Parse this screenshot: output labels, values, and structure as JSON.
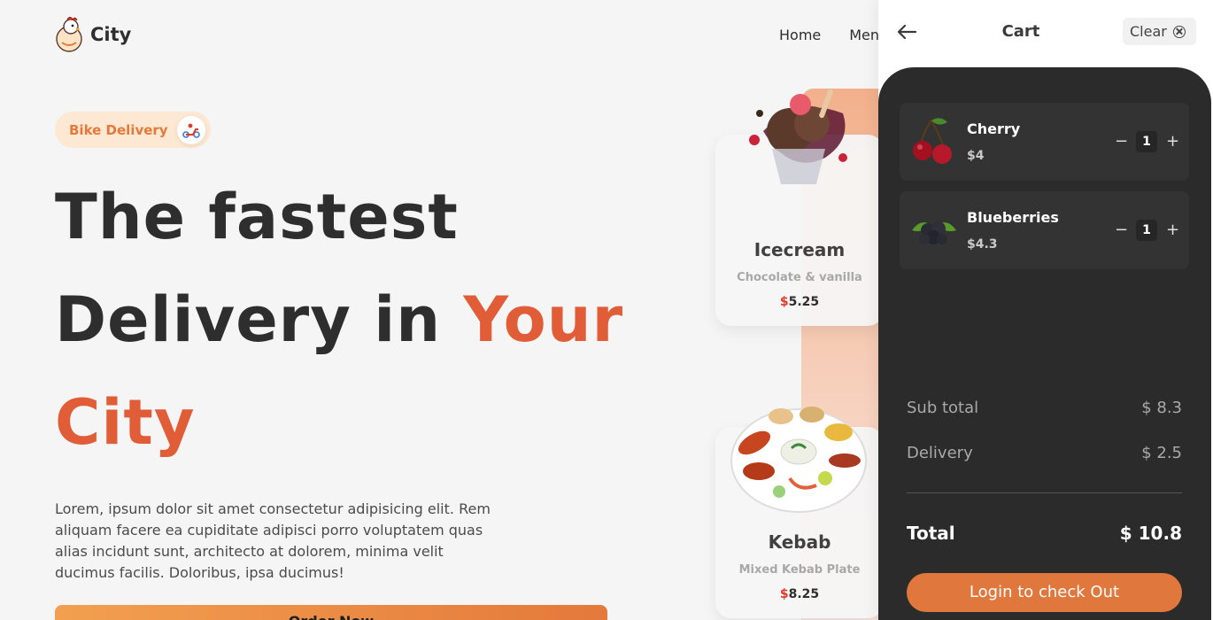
{
  "header": {
    "logo_text": "City",
    "nav": [
      "Home",
      "Menu"
    ]
  },
  "hero": {
    "badge_text": "Bike Delivery",
    "title_line1": "The fastest",
    "title_line2_plain": "Delivery in ",
    "title_line2_accent": "Your",
    "title_line3": "City",
    "paragraph": "Lorem, ipsum dolor sit amet consectetur adipisicing elit. Rem aliquam facere ea cupiditate adipisci porro voluptatem quas alias incidunt sunt, architecto at dolorem, minima velit ducimus facilis. Doloribus, ipsa ducimus!",
    "order_button": "Order Now"
  },
  "menu_cards": [
    {
      "name": "Icecream",
      "desc": "Chocolate & vanilla",
      "currency": "$",
      "price": "5.25"
    },
    {
      "name": "Kebab",
      "desc": "Mixed Kebab Plate",
      "currency": "$",
      "price": "8.25"
    }
  ],
  "cart": {
    "title": "Cart",
    "clear_label": "Clear",
    "items": [
      {
        "name": "Cherry",
        "price": "$4",
        "qty": "1",
        "minus": "−",
        "plus": "+"
      },
      {
        "name": "Blueberries",
        "price": "$4.3",
        "qty": "1",
        "minus": "−",
        "plus": "+"
      }
    ],
    "subtotal_label": "Sub total",
    "subtotal_value": "$ 8.3",
    "delivery_label": "Delivery",
    "delivery_value": "$ 2.5",
    "total_label": "Total",
    "total_value": "$ 10.8",
    "checkout_label": "Login to check Out"
  },
  "colors": {
    "accent": "#e05d37",
    "button_orange": "#e0773d",
    "cart_bg": "#2b2b2b"
  }
}
